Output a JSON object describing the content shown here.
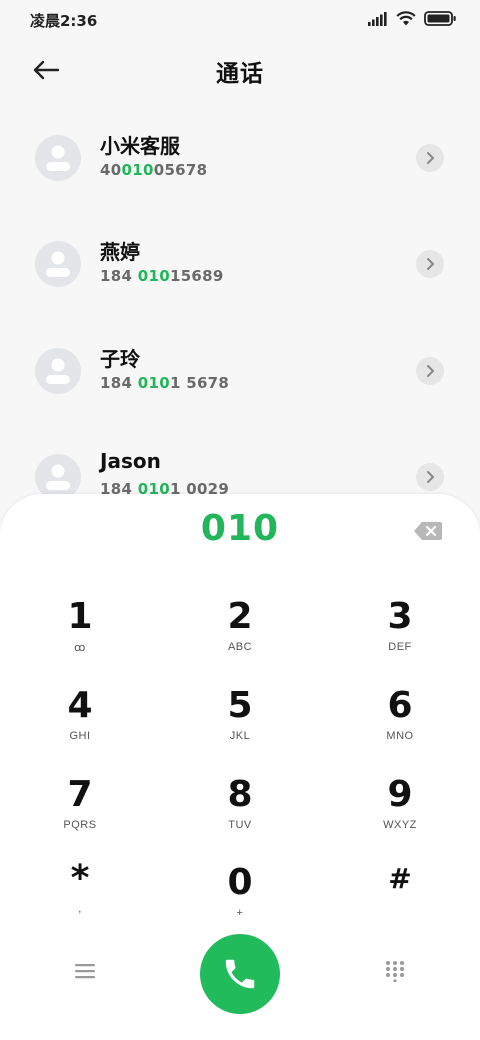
{
  "status_bar": {
    "time": "凌晨2:36",
    "icons": [
      "signal-icon",
      "wifi-icon",
      "battery-icon"
    ]
  },
  "header": {
    "title": "通话",
    "back_icon": "arrow-left-icon"
  },
  "contacts": [
    {
      "name": "小米客服",
      "number_parts": [
        "40",
        "010",
        "05678"
      ]
    },
    {
      "name": "燕婷",
      "number_parts": [
        "184 ",
        "010",
        "15689"
      ]
    },
    {
      "name": "子玲",
      "number_parts": [
        "184 ",
        "010",
        "1 5678"
      ]
    },
    {
      "name": "Jason",
      "number_parts": [
        "184 ",
        "010",
        "1 0029"
      ]
    }
  ],
  "dialpad": {
    "input": "010",
    "keys": [
      {
        "digit": "1",
        "letters": "ꝏ"
      },
      {
        "digit": "2",
        "letters": "ABC"
      },
      {
        "digit": "3",
        "letters": "DEF"
      },
      {
        "digit": "4",
        "letters": "GHI"
      },
      {
        "digit": "5",
        "letters": "JKL"
      },
      {
        "digit": "6",
        "letters": "MNO"
      },
      {
        "digit": "7",
        "letters": "PQRS"
      },
      {
        "digit": "8",
        "letters": "TUV"
      },
      {
        "digit": "9",
        "letters": "WXYZ"
      },
      {
        "digit": "*",
        "letters": ","
      },
      {
        "digit": "0",
        "letters": "+"
      },
      {
        "digit": "#",
        "letters": ""
      }
    ],
    "bottom_icons": [
      "menu-icon",
      "phone-icon",
      "keypad-icon"
    ]
  },
  "colors": {
    "accent": "#22b55a",
    "call_button": "#21bb5c",
    "background": "#f7f7f7"
  }
}
